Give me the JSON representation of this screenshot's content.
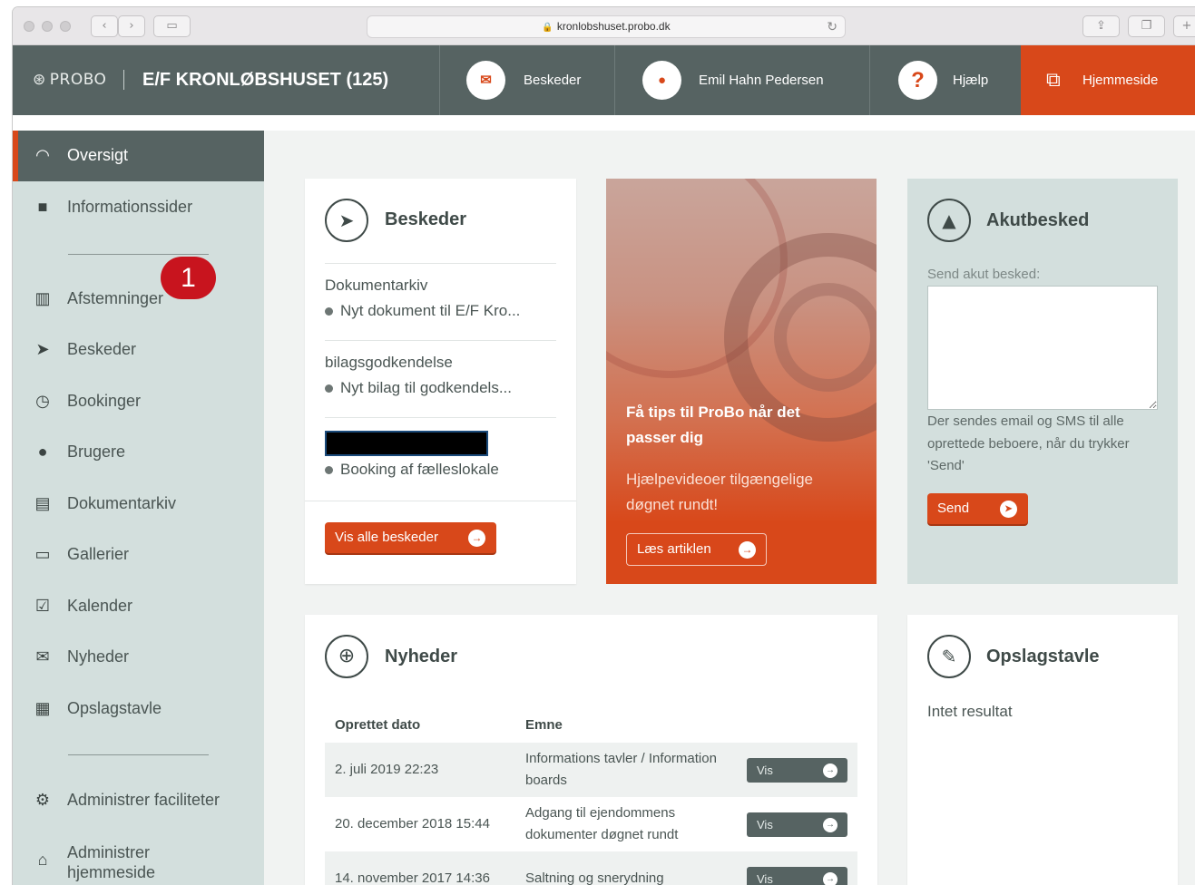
{
  "browser": {
    "url": "kronlobshuset.probo.dk"
  },
  "topbar": {
    "logo": "PROBO",
    "title": "E/F KRONLØBSHUSET (125)",
    "nav": [
      {
        "label": "Beskeder",
        "icon": "inbox-icon"
      },
      {
        "label": "Emil Hahn Pedersen",
        "icon": "user-icon"
      },
      {
        "label": "Hjælp",
        "icon": "question-icon"
      },
      {
        "label": "Hjemmeside",
        "icon": "external-link-icon"
      }
    ],
    "colors": {
      "bar": "#566362",
      "accent": "#d8481a"
    }
  },
  "sidebar": {
    "items": [
      {
        "label": "Oversigt",
        "icon": "gauge-icon",
        "active": true
      },
      {
        "label": "Informationssider",
        "icon": "book-icon"
      },
      {
        "label": "Afstemninger",
        "icon": "chart-board-icon"
      },
      {
        "label": "Beskeder",
        "icon": "paper-plane-icon"
      },
      {
        "label": "Bookinger",
        "icon": "clock-icon"
      },
      {
        "label": "Brugere",
        "icon": "user-icon"
      },
      {
        "label": "Dokumentarkiv",
        "icon": "archive-icon"
      },
      {
        "label": "Gallerier",
        "icon": "frame-icon"
      },
      {
        "label": "Kalender",
        "icon": "calendar-icon"
      },
      {
        "label": "Nyheder",
        "icon": "envelope-icon"
      },
      {
        "label": "Opslagstavle",
        "icon": "board-icon"
      },
      {
        "label": "Administrer faciliteter",
        "icon": "gear-circle-icon"
      },
      {
        "label": "Administrer hjemmeside",
        "icon": "home-circle-icon"
      }
    ],
    "badge": "1"
  },
  "messages": {
    "title": "Beskeder",
    "groups": [
      {
        "heading": "Dokumentarkiv",
        "line": "Nyt dokument til E/F Kro..."
      },
      {
        "heading": "bilagsgodkendelse",
        "line": "Nyt bilag til godkendels..."
      },
      {
        "heading": "",
        "line": "Booking af fælleslokale"
      }
    ],
    "button": "Vis alle beskeder"
  },
  "promo": {
    "title": "Få tips til ProBo når det passer dig",
    "subtitle": "Hjælpevideoer tilgængelige døgnet rundt!",
    "button": "Læs artiklen"
  },
  "akut": {
    "title": "Akutbesked",
    "label": "Send akut besked:",
    "note": "Der sendes email og SMS til alle oprettede beboere, når du trykker 'Send'",
    "button": "Send"
  },
  "news": {
    "title": "Nyheder",
    "columns": [
      "Oprettet dato",
      "Emne"
    ],
    "rows": [
      {
        "date": "2. juli 2019 22:23",
        "subject": "Informations tavler / Information boards",
        "action": "Vis"
      },
      {
        "date": "20. december 2018 15:44",
        "subject": "Adgang til ejendommens dokumenter døgnet rundt",
        "action": "Vis"
      },
      {
        "date": "14. november 2017 14:36",
        "subject": "Saltning og snerydning",
        "action": "Vis"
      }
    ]
  },
  "board": {
    "title": "Opslagstavle",
    "empty": "Intet resultat"
  }
}
